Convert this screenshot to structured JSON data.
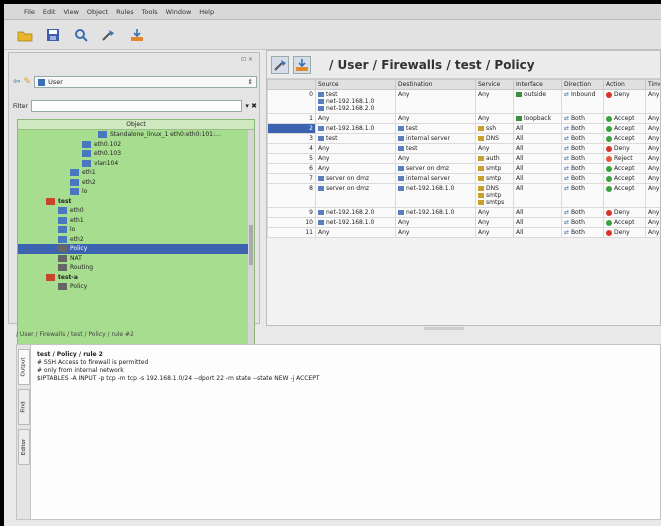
{
  "menu": [
    "File",
    "Edit",
    "View",
    "Object",
    "Rules",
    "Tools",
    "Window",
    "Help"
  ],
  "library": {
    "selected": "User"
  },
  "filter": {
    "label": "Filter",
    "value": ""
  },
  "tree": {
    "header": "Object",
    "rows": [
      {
        "label": "Standalone_linux_1 eth0:eth0:101:...",
        "indent": 80,
        "icon": "interface-icon",
        "selected": false
      },
      {
        "label": "eth0.102",
        "indent": 64,
        "icon": "interface-icon",
        "selected": false
      },
      {
        "label": "eth0.103",
        "indent": 64,
        "icon": "interface-icon",
        "selected": false
      },
      {
        "label": "vlan104",
        "indent": 64,
        "icon": "interface-icon",
        "selected": false
      },
      {
        "label": "eth1",
        "indent": 52,
        "icon": "interface-icon",
        "selected": false
      },
      {
        "label": "eth2",
        "indent": 52,
        "icon": "interface-icon",
        "selected": false
      },
      {
        "label": "lo",
        "indent": 52,
        "icon": "interface-icon",
        "selected": false
      },
      {
        "label": "test",
        "indent": 28,
        "icon": "firewall-icon",
        "selected": false,
        "bold": true
      },
      {
        "label": "eth0",
        "indent": 40,
        "icon": "interface-icon",
        "selected": false
      },
      {
        "label": "eth1",
        "indent": 40,
        "icon": "interface-icon",
        "selected": false
      },
      {
        "label": "lo",
        "indent": 40,
        "icon": "interface-icon",
        "selected": false
      },
      {
        "label": "eth2",
        "indent": 40,
        "icon": "interface-icon",
        "selected": false
      },
      {
        "label": "Policy",
        "indent": 40,
        "icon": "policy-icon",
        "selected": true
      },
      {
        "label": "NAT",
        "indent": 40,
        "icon": "policy-icon",
        "selected": false
      },
      {
        "label": "Routing",
        "indent": 40,
        "icon": "policy-icon",
        "selected": false
      },
      {
        "label": "test-a",
        "indent": 28,
        "icon": "firewall-icon",
        "selected": false,
        "bold": true
      },
      {
        "label": "Policy",
        "indent": 40,
        "icon": "policy-icon",
        "selected": false
      }
    ]
  },
  "policy": {
    "title": "/ User / Firewalls / test / Policy",
    "columns": [
      "",
      "Source",
      "Destination",
      "Service",
      "Interface",
      "Direction",
      "Action",
      "Time"
    ],
    "rows": [
      {
        "num": "0",
        "source": [
          "test",
          "net-192.168.1.0",
          "net-192.168.2.0"
        ],
        "destination": [
          "Any"
        ],
        "service": [
          "Any"
        ],
        "interface": [
          "outside"
        ],
        "direction": "Inbound",
        "action": "Deny",
        "time": "Any",
        "selected": false
      },
      {
        "num": "1",
        "source": [
          "Any"
        ],
        "destination": [
          "Any"
        ],
        "service": [
          "Any"
        ],
        "interface": [
          "loopback"
        ],
        "direction": "Both",
        "action": "Accept",
        "time": "Any",
        "selected": false
      },
      {
        "num": "2",
        "source": [
          "net-192.168.1.0"
        ],
        "destination": [
          "test"
        ],
        "service": [
          "ssh"
        ],
        "interface": [
          "All"
        ],
        "direction": "Both",
        "action": "Accept",
        "time": "Any",
        "selected": true
      },
      {
        "num": "3",
        "source": [
          "test"
        ],
        "destination": [
          "internal server"
        ],
        "service": [
          "DNS"
        ],
        "interface": [
          "All"
        ],
        "direction": "Both",
        "action": "Accept",
        "time": "Any",
        "selected": false
      },
      {
        "num": "4",
        "source": [
          "Any"
        ],
        "destination": [
          "test"
        ],
        "service": [
          "Any"
        ],
        "interface": [
          "All"
        ],
        "direction": "Both",
        "action": "Deny",
        "time": "Any",
        "selected": false
      },
      {
        "num": "5",
        "source": [
          "Any"
        ],
        "destination": [
          "Any"
        ],
        "service": [
          "auth"
        ],
        "interface": [
          "All"
        ],
        "direction": "Both",
        "action": "Reject",
        "time": "Any",
        "selected": false
      },
      {
        "num": "6",
        "source": [
          "Any"
        ],
        "destination": [
          "server on dmz"
        ],
        "service": [
          "smtp"
        ],
        "interface": [
          "All"
        ],
        "direction": "Both",
        "action": "Accept",
        "time": "Any",
        "selected": false
      },
      {
        "num": "7",
        "source": [
          "server on dmz"
        ],
        "destination": [
          "internal server"
        ],
        "service": [
          "smtp"
        ],
        "interface": [
          "All"
        ],
        "direction": "Both",
        "action": "Accept",
        "time": "Any",
        "selected": false
      },
      {
        "num": "8",
        "source": [
          "server on dmz"
        ],
        "destination": [
          "net-192.168.1.0"
        ],
        "service": [
          "DNS",
          "smtp",
          "smtps"
        ],
        "interface": [
          "All"
        ],
        "direction": "Both",
        "action": "Accept",
        "time": "Any",
        "selected": false
      },
      {
        "num": "9",
        "source": [
          "net-192.168.2.0"
        ],
        "destination": [
          "net-192.168.1.0"
        ],
        "service": [
          "Any"
        ],
        "interface": [
          "All"
        ],
        "direction": "Both",
        "action": "Deny",
        "time": "Any",
        "selected": false
      },
      {
        "num": "10",
        "source": [
          "net-192.168.1.0"
        ],
        "destination": [
          "Any"
        ],
        "service": [
          "Any"
        ],
        "interface": [
          "All"
        ],
        "direction": "Both",
        "action": "Accept",
        "time": "Any",
        "selected": false
      },
      {
        "num": "11",
        "source": [
          "Any"
        ],
        "destination": [
          "Any"
        ],
        "service": [
          "Any"
        ],
        "interface": [
          "All"
        ],
        "direction": "Both",
        "action": "Deny",
        "time": "Any",
        "selected": false
      }
    ]
  },
  "editor": {
    "path": "/ User / Firewalls / test / Policy / rule #2",
    "tabs": [
      "Output",
      "Find",
      "Editor"
    ],
    "title": "test / Policy / rule 2",
    "lines": [
      "# SSH Access to firewall is permitted",
      "# only from internal network",
      "$IPTABLES -A INPUT -p tcp -m tcp  -s 192.168.1.0/24   --dport 22  -m state --state NEW  -j ACCEPT"
    ]
  },
  "colors": {
    "tree_bg": "#a7dd8e",
    "selection": "#3c63b0",
    "accept": "#3aa23a",
    "deny": "#d8342c",
    "reject": "#e05a3a"
  }
}
